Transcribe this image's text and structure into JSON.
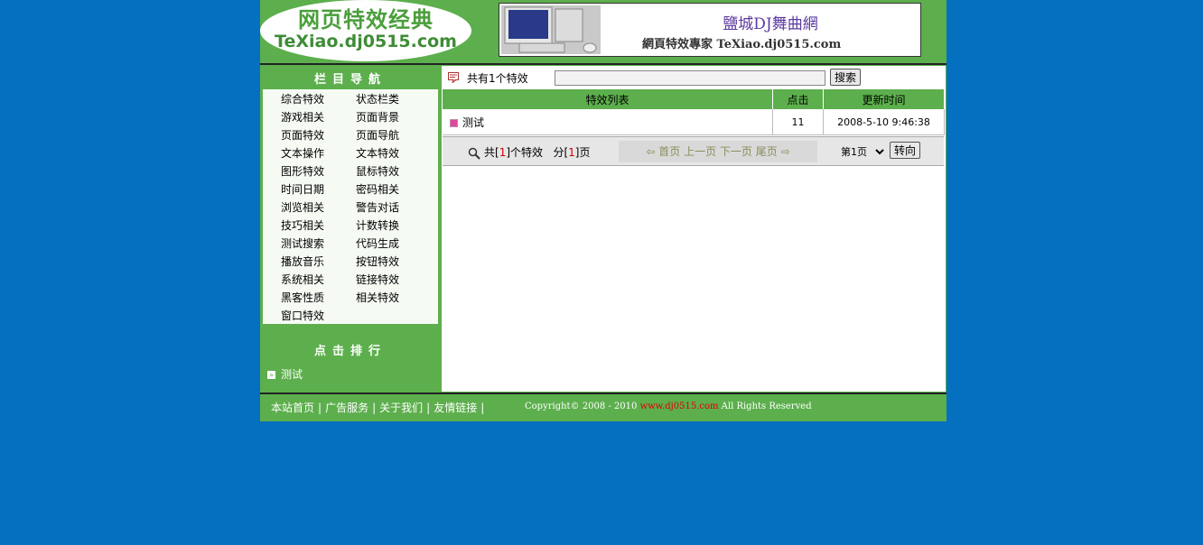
{
  "header": {
    "logo_title": "网页特效经典",
    "logo_url": "TeXiao.dj0515.com",
    "banner_title": "鹽城DJ舞曲網",
    "banner_subtitle": "網頁特效專家 TeXiao.dj0515.com"
  },
  "sidebar": {
    "nav_heading": "栏目导航",
    "nav_items": [
      "综合特效",
      "状态栏类",
      "游戏相关",
      "页面背景",
      "页面特效",
      "页面导航",
      "文本操作",
      "文本特效",
      "图形特效",
      "鼠标特效",
      "时间日期",
      "密码相关",
      "浏览相关",
      "警告对话",
      "技巧相关",
      "计数转换",
      "测试搜索",
      "代码生成",
      "播放音乐",
      "按钮特效",
      "系统相关",
      "链接特效",
      "黑客性质",
      "相关特效",
      "窗口特效"
    ],
    "rank_heading": "点击排行",
    "rank_items": [
      "测试"
    ]
  },
  "main": {
    "count_text": "共有1个特效",
    "search_value": "",
    "search_button": "搜索",
    "table": {
      "headers": [
        "特效列表",
        "点击",
        "更新时间"
      ],
      "rows": [
        {
          "name": "测试",
          "clicks": "11",
          "updated": "2008-5-10 9:46:38"
        }
      ]
    },
    "pager": {
      "prefix_total": "共[",
      "total": "1",
      "suffix_total": "]个特效",
      "prefix_pages": "分[",
      "pages": "1",
      "suffix_pages": "]页",
      "first": "首页",
      "prev": "上一页",
      "next": "下一页",
      "last": "尾页",
      "select_value": "第1页",
      "go_button": "转向"
    }
  },
  "footer": {
    "links": [
      "本站首页",
      "广告服务",
      "关于我们",
      "友情链接"
    ],
    "copyright_prefix": "Copyright© 2008 - 2010",
    "copyright_site": "www.dj0515.com",
    "copyright_suffix": "All Rights Reserved"
  },
  "colors": {
    "background": "#0570bf",
    "green": "#5caf4c",
    "highlight_red": "#cc0000"
  }
}
